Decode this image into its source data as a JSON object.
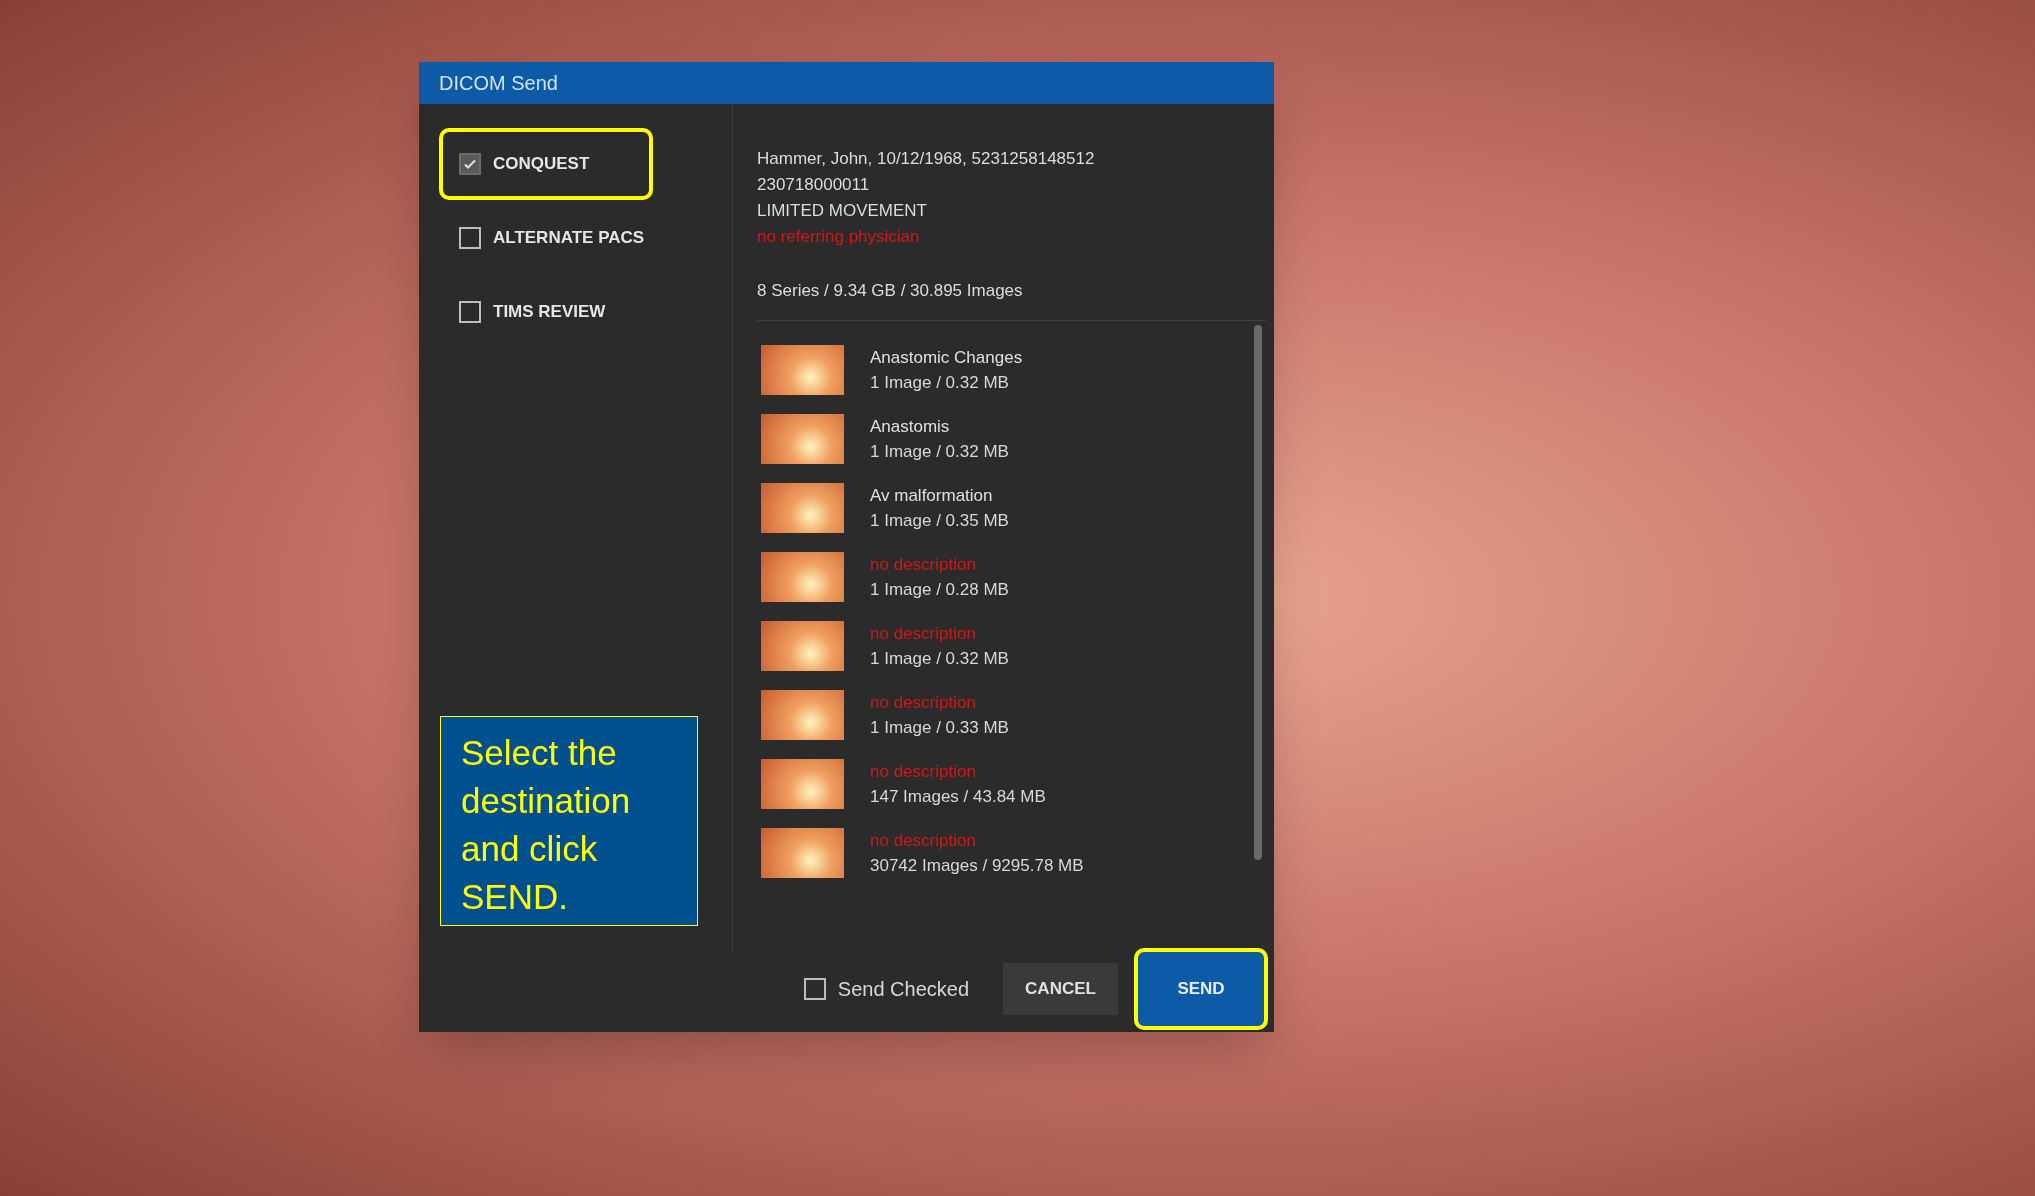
{
  "dialog": {
    "title": "DICOM Send"
  },
  "destinations": [
    {
      "label": "CONQUEST",
      "checked": true,
      "highlighted": true
    },
    {
      "label": "ALTERNATE PACS",
      "checked": false,
      "highlighted": false
    },
    {
      "label": "TIMS REVIEW",
      "checked": false,
      "highlighted": false
    }
  ],
  "callout": {
    "text": "Select the destination and click SEND."
  },
  "patient": {
    "lines": [
      "Hammer, John, 10/12/1968, 5231258148512",
      "230718000011",
      "LIMITED MOVEMENT"
    ],
    "physician": "no referring physician",
    "summary": "8 Series / 9.34 GB / 30.895 Images"
  },
  "series": [
    {
      "description": "Anastomic Changes",
      "missing": false,
      "size": "1 Image / 0.32 MB"
    },
    {
      "description": "Anastomis",
      "missing": false,
      "size": "1 Image / 0.32 MB"
    },
    {
      "description": "Av malformation",
      "missing": false,
      "size": "1 Image / 0.35 MB"
    },
    {
      "description": "no description",
      "missing": true,
      "size": "1 Image / 0.28 MB"
    },
    {
      "description": "no description",
      "missing": true,
      "size": "1 Image / 0.32 MB"
    },
    {
      "description": "no description",
      "missing": true,
      "size": "1 Image / 0.33 MB"
    },
    {
      "description": "no description",
      "missing": true,
      "size": "147 Images / 43.84 MB"
    },
    {
      "description": "no description",
      "missing": true,
      "size": "30742 Images / 9295.78 MB"
    }
  ],
  "footer": {
    "send_checked": {
      "label": "Send Checked",
      "checked": false
    },
    "cancel": "CANCEL",
    "send": {
      "label": "SEND",
      "highlighted": true
    }
  }
}
